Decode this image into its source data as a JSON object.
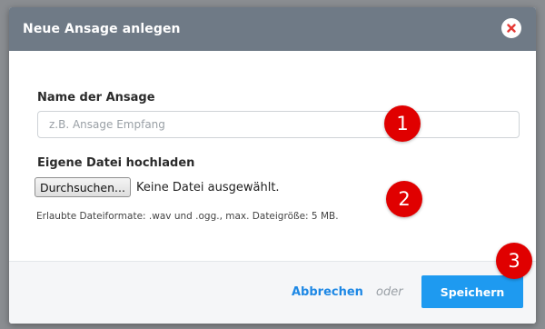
{
  "dialog": {
    "title": "Neue Ansage anlegen",
    "close_icon": "close-icon"
  },
  "form": {
    "name_label": "Name der Ansage",
    "name_placeholder": "z.B. Ansage Empfang",
    "name_value": "",
    "file_label": "Eigene Datei hochladen",
    "browse_label": "Durchsuchen...",
    "no_file_text": "Keine Datei ausgewählt.",
    "hint": "Erlaubte Dateiformate: .wav und .ogg., max. Dateigröße: 5 MB."
  },
  "footer": {
    "cancel_label": "Abbrechen",
    "or_text": "oder",
    "save_label": "Speichern"
  },
  "markers": [
    "1",
    "2",
    "3"
  ],
  "colors": {
    "header": "#6f7a86",
    "accent": "#1e9af0",
    "close_x": "#e53935",
    "marker": "#e00000"
  }
}
